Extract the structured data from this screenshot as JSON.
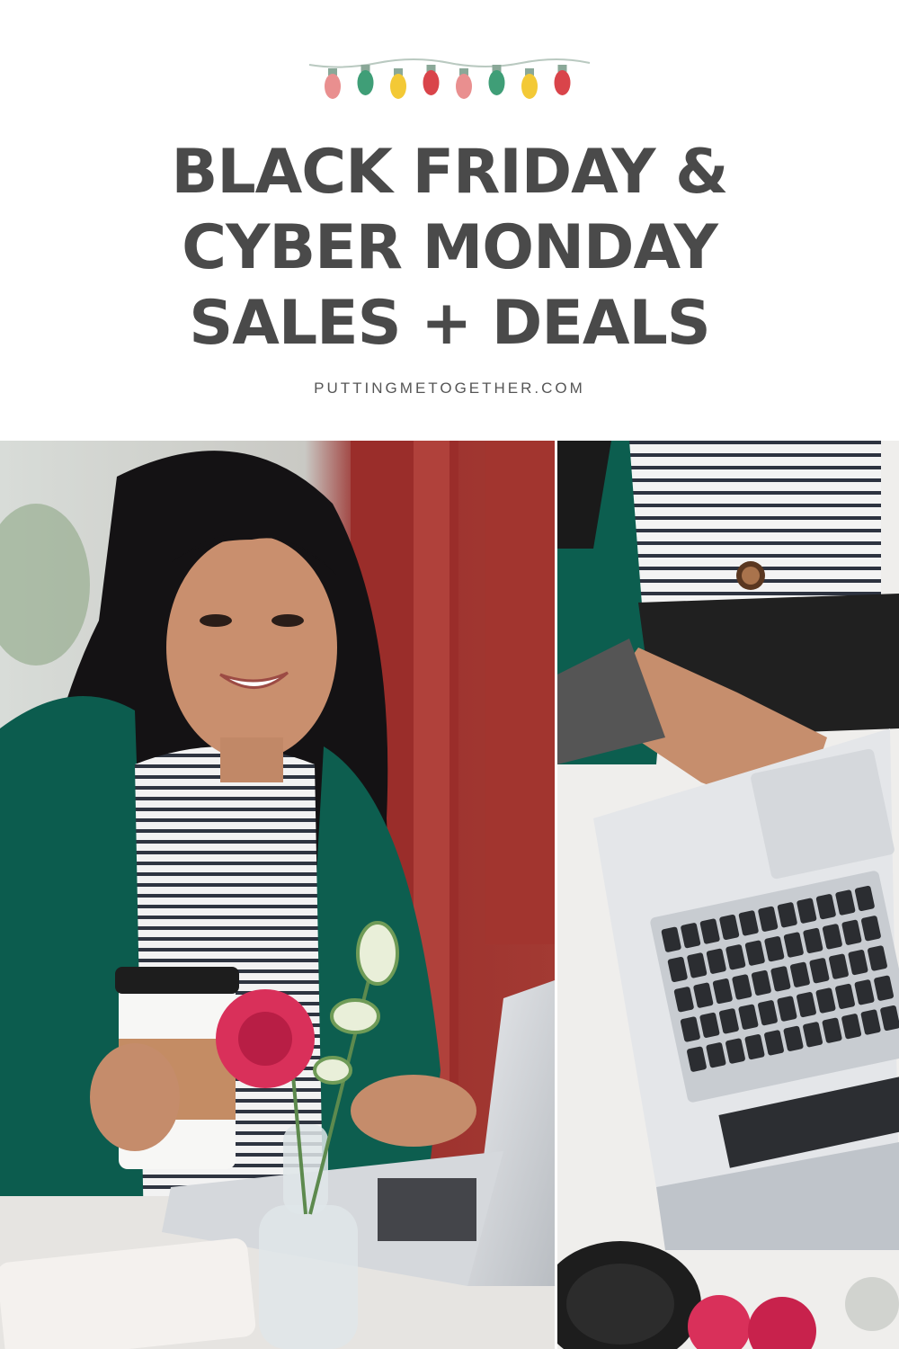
{
  "header": {
    "title_lines": [
      "BLACK FRIDAY &",
      "CYBER MONDAY",
      "SALES + DEALS"
    ],
    "site": "PUTTINGMETOGETHER.COM",
    "decoration_icon": "string-lights-icon",
    "light_colors": [
      "#e98f8f",
      "#3f9e77",
      "#f3c936",
      "#d9444a",
      "#e98f8f",
      "#3f9e77",
      "#f3c936",
      "#d9444a"
    ]
  },
  "photos": {
    "left": "woman-with-coffee-and-laptop",
    "right": "overhead-laptop-typing"
  }
}
